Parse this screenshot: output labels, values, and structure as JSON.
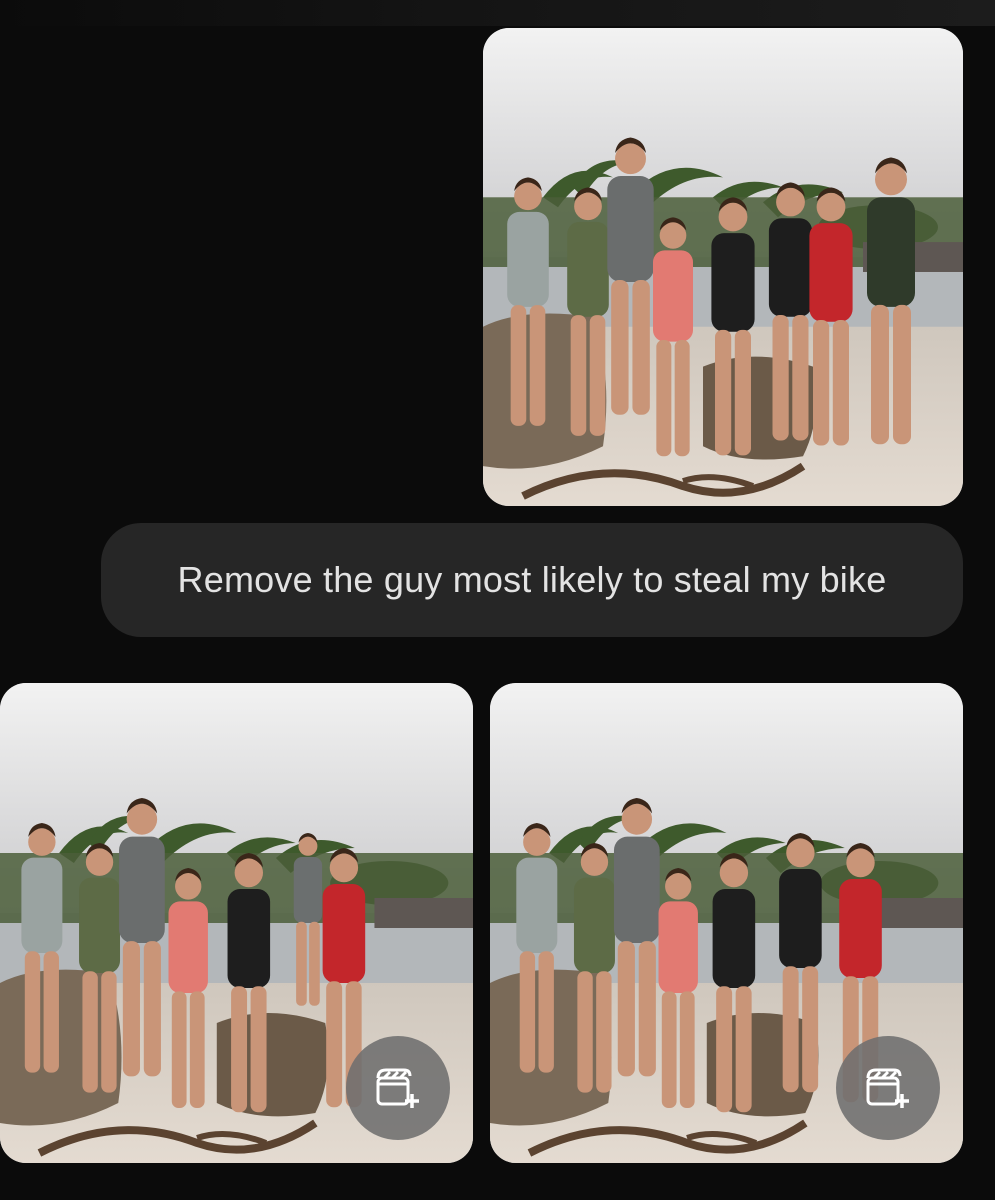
{
  "prompt": {
    "text": "Remove the guy most likely to steal my bike"
  },
  "images": {
    "input": {
      "alt": "Group photo of eight friends posing on a beach rock"
    },
    "results": [
      {
        "alt": "Edited group photo with one person removed"
      },
      {
        "alt": "Edited group photo with one person removed"
      }
    ]
  },
  "actions": {
    "add_to_video_icon": "clapperboard-plus-icon"
  },
  "colors": {
    "background": "#0b0b0b",
    "bubble": "#262626",
    "bubble_text": "#e3e3e3",
    "fab": "#6e6e6e"
  }
}
